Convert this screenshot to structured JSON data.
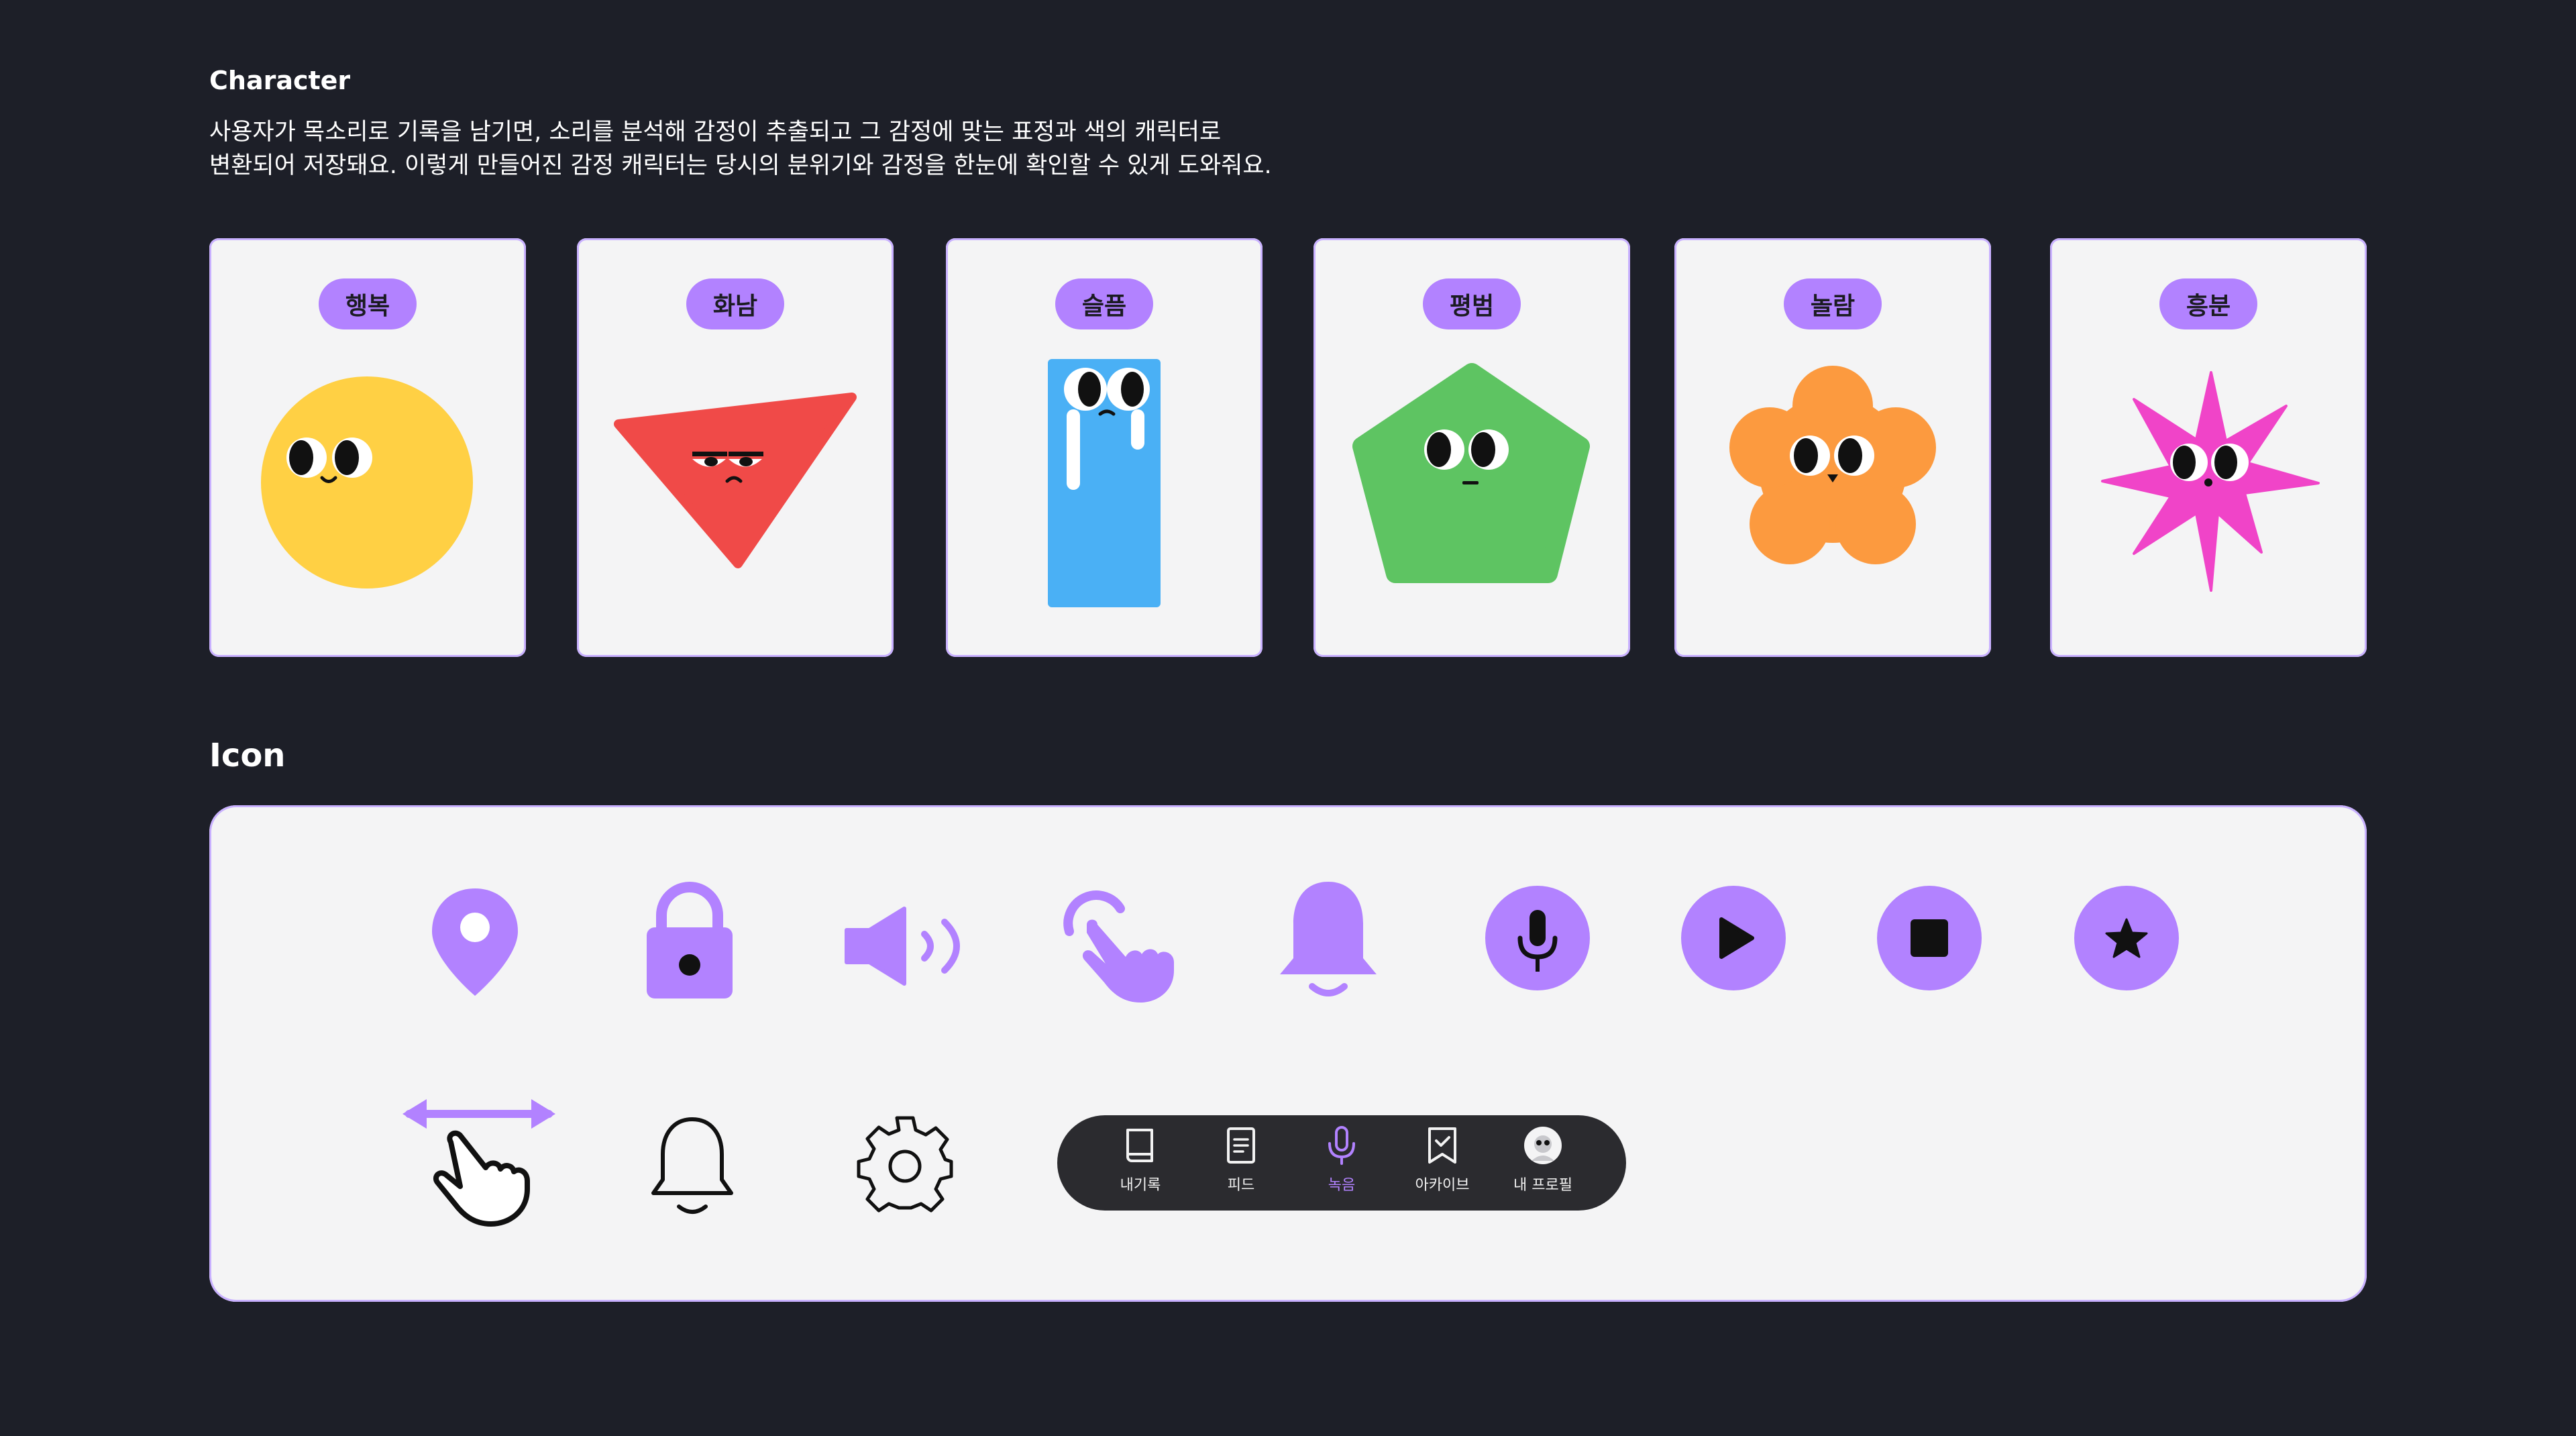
{
  "character_section": {
    "title": "Character",
    "description_line1": "사용자가 목소리로 기록을 남기면, 소리를 분석해 감정이 추출되고 그 감정에 맞는 표정과 색의 캐릭터로",
    "description_line2": "변환되어 저장돼요. 이렇게 만들어진 감정 캐릭터는 당시의 분위기와 감정을 한눈에 확인할 수 있게 도와줘요.",
    "cards": [
      {
        "label": "행복",
        "color": "#ffd044",
        "shape": "circle"
      },
      {
        "label": "화남",
        "color": "#f04a48",
        "shape": "triangle"
      },
      {
        "label": "슬픔",
        "color": "#4ab0f5",
        "shape": "rectangle"
      },
      {
        "label": "평범",
        "color": "#5ec462",
        "shape": "pentagon"
      },
      {
        "label": "놀람",
        "color": "#fc9a3f",
        "shape": "flower"
      },
      {
        "label": "흥분",
        "color": "#f044c8",
        "shape": "star-burst"
      }
    ]
  },
  "icon_section": {
    "title": "Icon",
    "accent_color": "#b282ff",
    "icons_row1": [
      "location-pin-icon",
      "lock-icon",
      "speaker-volume-icon",
      "tap-gesture-icon",
      "bell-filled-icon",
      "microphone-circle-icon",
      "play-circle-icon",
      "stop-circle-icon",
      "star-circle-icon"
    ],
    "icons_row2": [
      "swipe-gesture-icon",
      "bell-outline-icon",
      "gear-icon"
    ],
    "tab_bar": {
      "tabs": [
        {
          "label": "내기록",
          "icon": "book-icon",
          "active": false
        },
        {
          "label": "피드",
          "icon": "document-icon",
          "active": false
        },
        {
          "label": "녹음",
          "icon": "microphone-icon",
          "active": true
        },
        {
          "label": "아카이브",
          "icon": "bookmark-check-icon",
          "active": false
        },
        {
          "label": "내 프로필",
          "icon": "avatar-icon",
          "active": false
        }
      ]
    }
  }
}
